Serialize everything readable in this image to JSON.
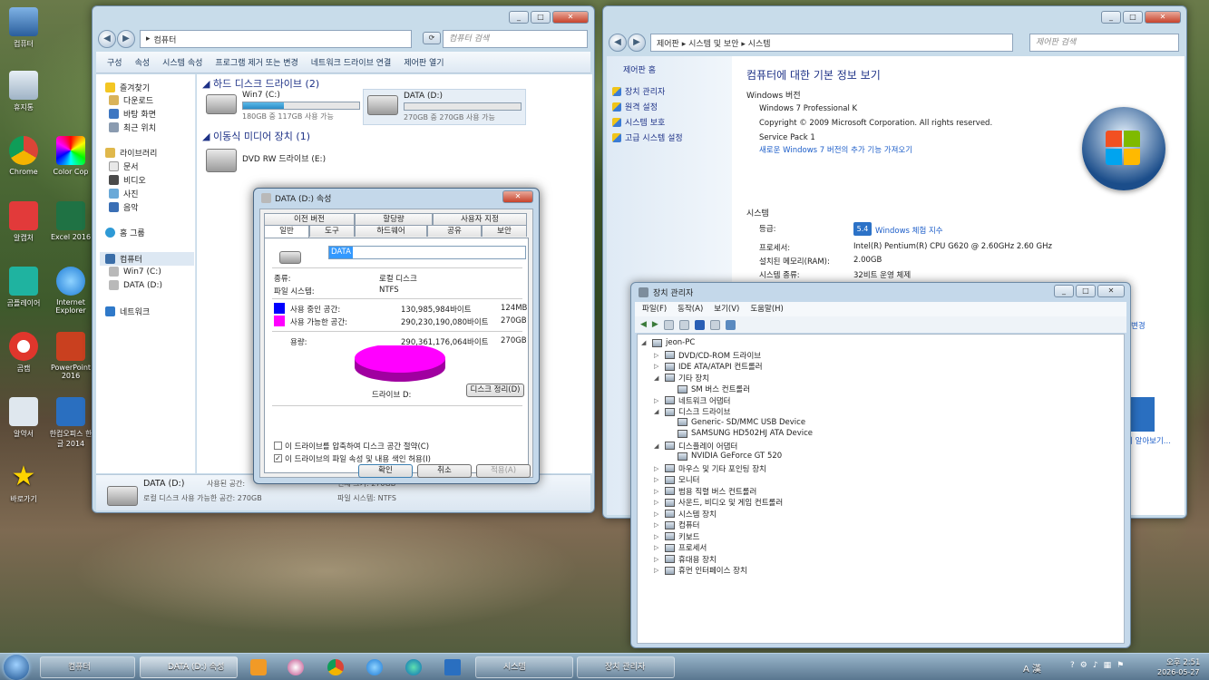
{
  "desktop": {
    "icons": [
      "컴퓨터",
      "휴지통",
      "Chrome",
      "Color Cop",
      "알캡처",
      "Excel 2016",
      "곰플레이어",
      "Internet Explorer",
      "곰캠",
      "PowerPoint 2016",
      "알약서",
      "한컴오피스 한글 2014",
      "바로가기"
    ]
  },
  "explorer": {
    "address": "컴퓨터",
    "search_placeholder": "컴퓨터 검색",
    "toolbar": [
      "구성",
      "속성",
      "시스템 속성",
      "프로그램 제거 또는 변경",
      "네트워크 드라이브 연결",
      "제어판 열기"
    ],
    "nav": {
      "favorites": "즐겨찾기",
      "downloads": "다운로드",
      "desktop": "바탕 화면",
      "recent": "최근 위치",
      "libraries": "라이브러리",
      "documents": "문서",
      "video": "비디오",
      "pictures": "사진",
      "music": "음악",
      "homegroup": "홈 그룹",
      "computer": "컴퓨터",
      "win7": "Win7 (C:)",
      "data": "DATA (D:)",
      "network": "네트워크"
    },
    "hdd_header": "하드 디스크 드라이브 (2)",
    "drives": [
      {
        "name": "Win7 (C:)",
        "free": "180GB 중 117GB 사용 가능",
        "used_fraction": 0.35
      },
      {
        "name": "DATA (D:)",
        "free": "270GB 중 270GB 사용 가능",
        "used_fraction": 0.0
      }
    ],
    "removable_header": "이동식 미디어 장치 (1)",
    "dvd": "DVD RW 드라이브 (E:)",
    "status": {
      "name": "DATA (D:)",
      "used_label": "사용된 공간:",
      "free_label": "로컬 디스크  사용 가능한 공간: 270GB",
      "total": "전체 크기: 270GB",
      "fs": "파일 시스템: NTFS"
    }
  },
  "dialog": {
    "title": "DATA (D:) 속성",
    "tabs_top": [
      "이전 버전",
      "할당량",
      "사용자 지정"
    ],
    "tabs_bottom": [
      "일반",
      "도구",
      "하드웨어",
      "공유",
      "보안"
    ],
    "drive_label": "DATA",
    "type_label": "종류:",
    "type_value": "로컬 디스크",
    "fs_label": "파일 시스템:",
    "fs_value": "NTFS",
    "used_label": "사용 중인 공간:",
    "used_bytes": "130,985,984바이트",
    "used_size": "124MB",
    "free_label": "사용 가능한 공간:",
    "free_bytes": "290,230,190,080바이트",
    "free_size": "270GB",
    "cap_label": "용량:",
    "cap_bytes": "290,361,176,064바이트",
    "cap_size": "270GB",
    "drive_caption": "드라이브 D:",
    "cleanup": "디스크 정리(D)",
    "compress": "이 드라이브를 압축하여 디스크 공간 절약(C)",
    "index": "이 드라이브의 파일 속성 및 내용 색인 허용(I)",
    "ok": "확인",
    "cancel": "취소",
    "apply": "적용(A)",
    "colors": {
      "used": "#0000ff",
      "free": "#ff00ff"
    }
  },
  "system": {
    "address": "제어판 ▸ 시스템 및 보안 ▸ 시스템",
    "search_placeholder": "제어판 검색",
    "side_header": "제어판 홈",
    "side_links": [
      "장치 관리자",
      "원격 설정",
      "시스템 보호",
      "고급 시스템 설정"
    ],
    "heading": "컴퓨터에 대한 기본 정보 보기",
    "edition_header": "Windows 버전",
    "edition": "Windows 7 Professional K",
    "copyright": "Copyright © 2009 Microsoft Corporation. All rights reserved.",
    "sp": "Service Pack 1",
    "sp_link": "새로운 Windows 7 버전의 추가 기능 가져오기",
    "system_header": "시스템",
    "rating_label": "등급:",
    "rating_badge": "5.4",
    "rating_link": "Windows 체험 지수",
    "cpu_label": "프로세서:",
    "cpu": "Intel(R) Pentium(R) CPU G620 @ 2.60GHz   2.60 GHz",
    "ram_label": "설치된 메모리(RAM):",
    "ram": "2.00GB",
    "type_label": "시스템 종류:",
    "type": "32비트 운영 체제",
    "peek_change": "변경",
    "peek_more": "더 알아보기..."
  },
  "devmgr": {
    "title": "장치 관리자",
    "menu": [
      "파일(F)",
      "동작(A)",
      "보기(V)",
      "도움말(H)"
    ],
    "tree": [
      {
        "label": "jeon-PC",
        "level": 0,
        "exp": "◢"
      },
      {
        "label": "DVD/CD-ROM 드라이브",
        "level": 1,
        "exp": "▷"
      },
      {
        "label": "IDE ATA/ATAPI 컨트롤러",
        "level": 1,
        "exp": "▷"
      },
      {
        "label": "기타 장치",
        "level": 1,
        "exp": "◢"
      },
      {
        "label": "SM 버스 컨트롤러",
        "level": 2,
        "exp": ""
      },
      {
        "label": "네트워크 어댑터",
        "level": 1,
        "exp": "▷"
      },
      {
        "label": "디스크 드라이브",
        "level": 1,
        "exp": "◢"
      },
      {
        "label": "Generic- SD/MMC USB Device",
        "level": 2,
        "exp": ""
      },
      {
        "label": "SAMSUNG HD502HJ ATA Device",
        "level": 2,
        "exp": ""
      },
      {
        "label": "디스플레이 어댑터",
        "level": 1,
        "exp": "◢"
      },
      {
        "label": "NVIDIA GeForce GT 520",
        "level": 2,
        "exp": ""
      },
      {
        "label": "마우스 및 기타 포인팅 장치",
        "level": 1,
        "exp": "▷"
      },
      {
        "label": "모니터",
        "level": 1,
        "exp": "▷"
      },
      {
        "label": "범용 직렬 버스 컨트롤러",
        "level": 1,
        "exp": "▷"
      },
      {
        "label": "사운드, 비디오 및 게임 컨트롤러",
        "level": 1,
        "exp": "▷"
      },
      {
        "label": "시스템 장치",
        "level": 1,
        "exp": "▷"
      },
      {
        "label": "컴퓨터",
        "level": 1,
        "exp": "▷"
      },
      {
        "label": "키보드",
        "level": 1,
        "exp": "▷"
      },
      {
        "label": "프로세서",
        "level": 1,
        "exp": "▷"
      },
      {
        "label": "휴대용 장치",
        "level": 1,
        "exp": "▷"
      },
      {
        "label": "휴먼 인터페이스 장치",
        "level": 1,
        "exp": "▷"
      }
    ]
  },
  "taskbar": {
    "items": [
      "컴퓨터",
      "DATA (D:) 속성",
      "시스템",
      "장치 관리자"
    ],
    "tray": "A 漢",
    "time": "오후 2:51",
    "date": "2026-05-27"
  }
}
